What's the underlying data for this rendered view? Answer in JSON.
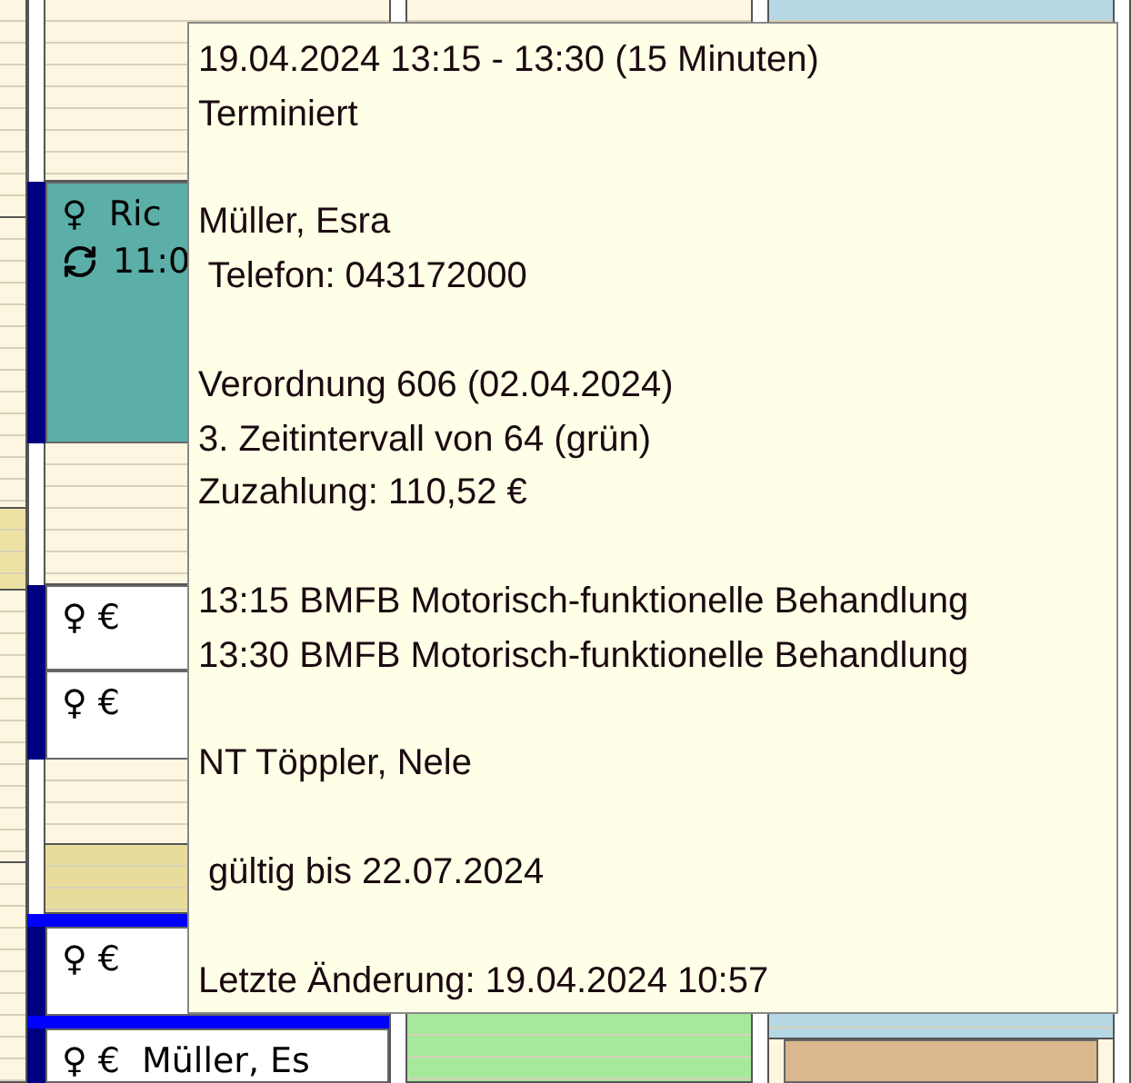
{
  "appointments": [
    {
      "kind": "recurring",
      "symbol": "♀",
      "title": "Ric",
      "time": "11:0"
    },
    {
      "kind": "plain",
      "symbol": "♀ €"
    },
    {
      "kind": "plain",
      "symbol": "♀ €"
    },
    {
      "kind": "plain",
      "symbol": "♀ €"
    },
    {
      "kind": "plain",
      "symbol": "♀ €",
      "title": "Müller, Es"
    }
  ],
  "tooltip": {
    "sections": [
      [
        "19.04.2024 13:15 - 13:30 (15 Minuten)",
        "Terminiert"
      ],
      [
        "Müller, Esra",
        " Telefon: 043172000"
      ],
      [
        "Verordnung 606 (02.04.2024)",
        "3. Zeitintervall von 64 (grün)",
        "Zuzahlung: 110,52 €"
      ],
      [
        "13:15 BMFB Motorisch-funktionelle Behandlung",
        "13:30 BMFB Motorisch-funktionelle Behandlung"
      ],
      [
        "NT Töppler, Nele"
      ],
      [
        " gültig bis 22.07.2024"
      ],
      [
        "Letzte Änderung: 19.04.2024 10:57"
      ]
    ]
  }
}
